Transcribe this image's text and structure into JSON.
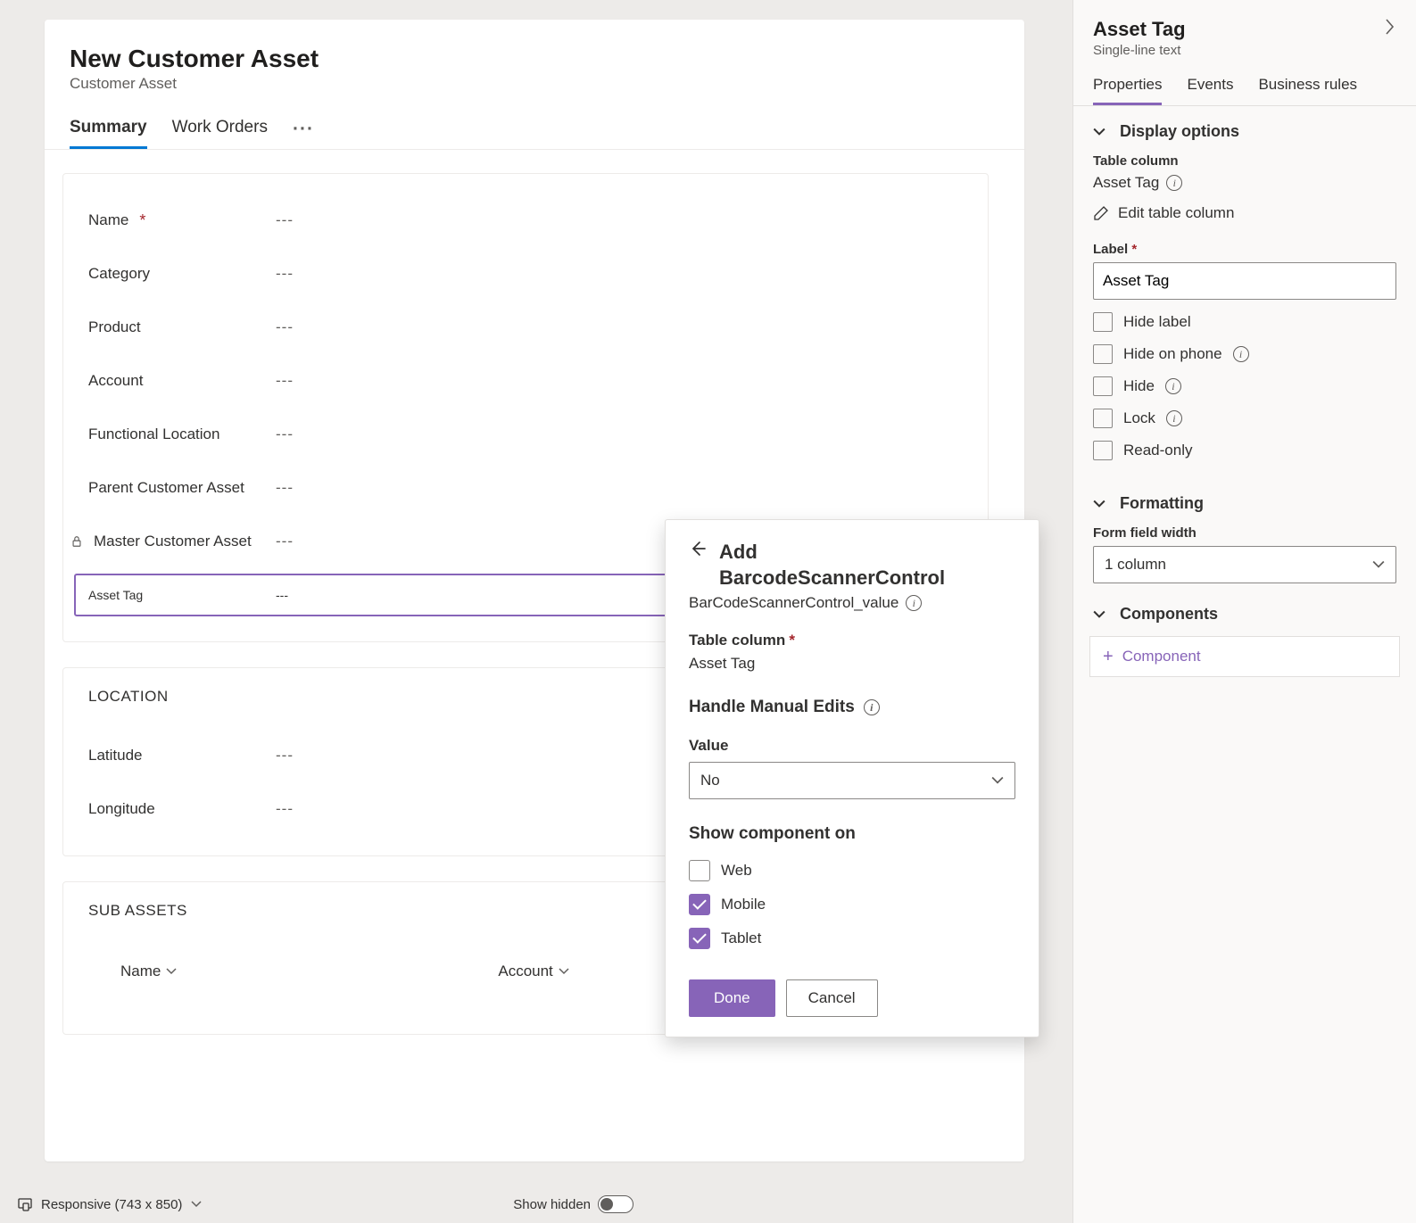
{
  "form": {
    "title": "New Customer Asset",
    "subtitle": "Customer Asset",
    "tabs": [
      {
        "label": "Summary",
        "active": true
      },
      {
        "label": "Work Orders",
        "active": false
      }
    ],
    "sections": {
      "general": {
        "fields": [
          {
            "label": "Name",
            "required": true,
            "value": "---",
            "locked": false
          },
          {
            "label": "Category",
            "required": false,
            "value": "---",
            "locked": false
          },
          {
            "label": "Product",
            "required": false,
            "value": "---",
            "locked": false
          },
          {
            "label": "Account",
            "required": false,
            "value": "---",
            "locked": false
          },
          {
            "label": "Functional Location",
            "required": false,
            "value": "---",
            "locked": false
          },
          {
            "label": "Parent Customer Asset",
            "required": false,
            "value": "---",
            "locked": false
          },
          {
            "label": "Master Customer Asset",
            "required": false,
            "value": "---",
            "locked": true
          }
        ],
        "selectedField": {
          "label": "Asset Tag",
          "value": "---"
        }
      },
      "location": {
        "title": "LOCATION",
        "fields": [
          {
            "label": "Latitude",
            "value": "---"
          },
          {
            "label": "Longitude",
            "value": "---"
          }
        ]
      },
      "subassets": {
        "title": "SUB ASSETS",
        "columns": [
          "Name",
          "Account"
        ]
      }
    }
  },
  "flyout": {
    "title_prefix": "Add",
    "title_main": "BarcodeScannerControl",
    "subtitle": "BarCodeScannerControl_value",
    "table_column_label": "Table column",
    "table_column_value": "Asset Tag",
    "handle_label": "Handle Manual Edits",
    "value_label": "Value",
    "value_selected": "No",
    "show_on_label": "Show component on",
    "show_on": {
      "web": {
        "label": "Web",
        "checked": false
      },
      "mobile": {
        "label": "Mobile",
        "checked": true
      },
      "tablet": {
        "label": "Tablet",
        "checked": true
      }
    },
    "buttons": {
      "done": "Done",
      "cancel": "Cancel"
    }
  },
  "rightPanel": {
    "title": "Asset Tag",
    "subtitle": "Single-line text",
    "tabs": [
      "Properties",
      "Events",
      "Business rules"
    ],
    "displayOptions": {
      "heading": "Display options",
      "tableColLabel": "Table column",
      "tableColValue": "Asset Tag",
      "editLink": "Edit table column",
      "labelLabel": "Label",
      "labelValue": "Asset Tag",
      "checks": {
        "hideLabel": "Hide label",
        "hideOnPhone": "Hide on phone",
        "hide": "Hide",
        "lock": "Lock",
        "readOnly": "Read-only"
      }
    },
    "formatting": {
      "heading": "Formatting",
      "widthLabel": "Form field width",
      "widthValue": "1 column"
    },
    "components": {
      "heading": "Components",
      "addLabel": "Component"
    }
  },
  "bottomBar": {
    "responsive": "Responsive (743 x 850)",
    "showHidden": "Show hidden"
  }
}
